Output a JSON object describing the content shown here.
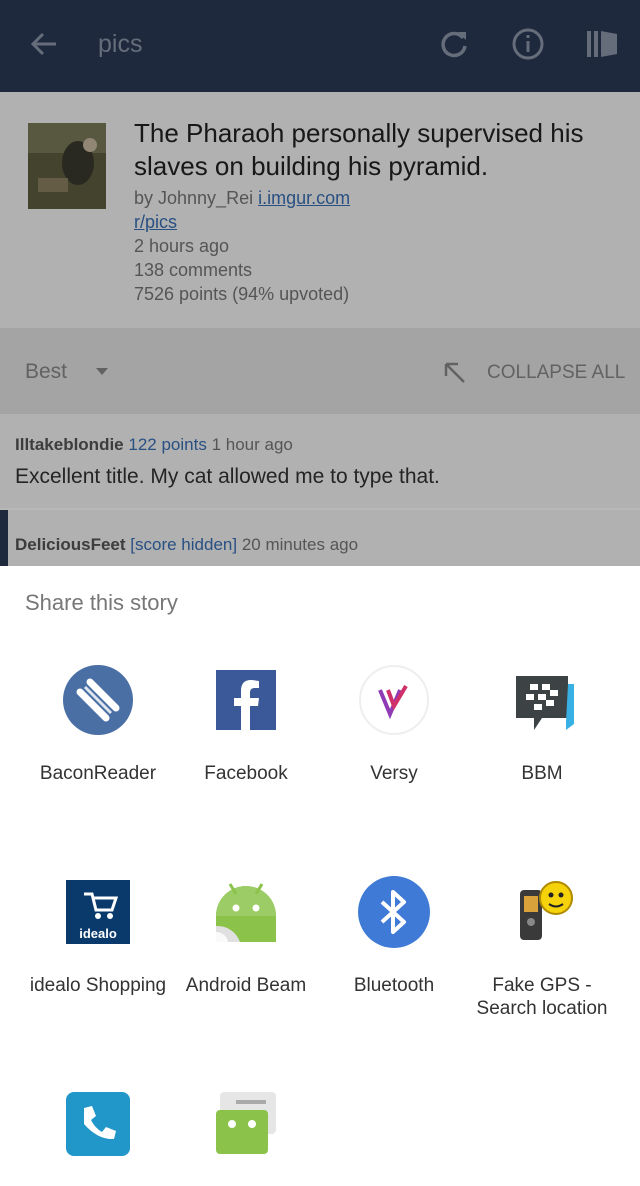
{
  "appbar": {
    "title": "pics",
    "icons": [
      "back-arrow-icon",
      "refresh-icon",
      "info-icon",
      "sidebar-icon"
    ],
    "color": "#2b3a55"
  },
  "post": {
    "title": "The Pharaoh personally supervised his slaves on building his pyramid.",
    "by_prefix": "by Johnny_Rei",
    "domain": "i.imgur.com",
    "subreddit": "r/pics",
    "time": "2 hours ago",
    "comments": "138 comments",
    "points": "7526 points (94% upvoted)"
  },
  "sortbar": {
    "sort": "Best",
    "collapse": "COLLAPSE ALL"
  },
  "comments": [
    {
      "user": "Illtakeblondie",
      "points": "122 points",
      "time": "1 hour ago",
      "body": "Excellent title. My cat allowed me to type that."
    },
    {
      "user": "DeliciousFeet",
      "points": "[score hidden]",
      "time": "20 minutes ago"
    }
  ],
  "share_sheet": {
    "title": "Share this story",
    "apps": [
      {
        "label": "BaconReader",
        "icon": "baconreader-icon"
      },
      {
        "label": "Facebook",
        "icon": "facebook-icon"
      },
      {
        "label": "Versy",
        "icon": "versy-icon"
      },
      {
        "label": "BBM",
        "icon": "bbm-icon"
      },
      {
        "label": "idealo Shopping",
        "icon": "idealo-icon"
      },
      {
        "label": "Android Beam",
        "icon": "android-beam-icon"
      },
      {
        "label": "Bluetooth",
        "icon": "bluetooth-icon"
      },
      {
        "label": "Fake GPS - Search location",
        "icon": "fake-gps-icon"
      },
      {
        "label": "",
        "icon": "phone-icon"
      },
      {
        "label": "",
        "icon": "messaging-icon"
      }
    ]
  },
  "icon_text": {
    "idealo": "idealo"
  }
}
